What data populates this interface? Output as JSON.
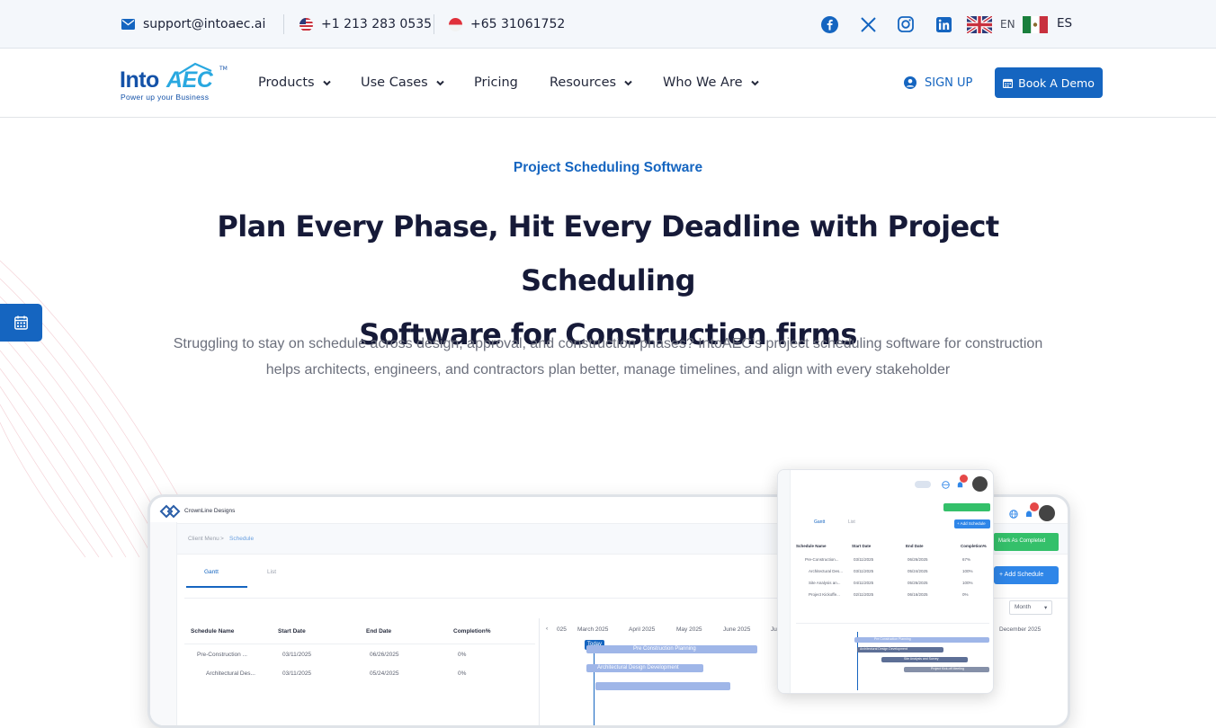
{
  "topbar": {
    "email": "support@intoaec.ai",
    "phone_us": "+1 213 283 0535",
    "phone_sg": "+65 31061752",
    "lang_en": "EN",
    "lang_es": "ES"
  },
  "nav": {
    "logo_into": "Into",
    "logo_aec": "AEC",
    "logo_tm": "TM",
    "logo_tagline": "Power up your Business",
    "items": [
      {
        "label": "Products"
      },
      {
        "label": "Use Cases"
      },
      {
        "label": "Pricing"
      },
      {
        "label": "Resources"
      },
      {
        "label": "Who We Are"
      }
    ],
    "signup": "SIGN UP",
    "book_demo": "Book A Demo"
  },
  "hero": {
    "eyebrow": "Project Scheduling Software",
    "headline_line1": "Plan Every Phase, Hit Every Deadline with Project Scheduling",
    "headline_line2": "Software for Construction firms",
    "subtext_line1": "Struggling to stay on schedule across design, approval, and construction phases? IntoAEC’s project scheduling software for construction",
    "subtext_line2": "helps architects, engineers, and contractors plan better, manage timelines, and align with every stakeholder"
  },
  "mock": {
    "company": "CrownLine Designs",
    "breadcrumb_root": "Client Menu",
    "breadcrumb_sep": ">",
    "breadcrumb_current": "Schedule",
    "tab_gantt": "Gantt",
    "tab_list": "List",
    "col_name": "Schedule Name",
    "col_start": "Start Date",
    "col_end": "End Date",
    "col_completion": "Completion%",
    "rows": [
      {
        "name": "Pre-Construction ...",
        "start": "03/11/2025",
        "end": "06/26/2025",
        "completion": "0%"
      },
      {
        "name": "Architectural Des...",
        "start": "03/11/2025",
        "end": "05/24/2025",
        "completion": "0%"
      }
    ],
    "months": [
      "025",
      "March 2025",
      "April 2025",
      "May 2025",
      "June 2025",
      "Ju",
      "December 2025"
    ],
    "today": "Today",
    "bar1": "Pre Construction Planning",
    "bar2": "Architectural Design Development",
    "mark_completed": "Mark As Completed",
    "add_schedule": "+ Add Schedule",
    "month_select": "Month"
  },
  "phone": {
    "tab_gantt": "Gantt",
    "tab_list": "List",
    "add_btn": "+ Add Schedule",
    "col_name": "Schedule Name",
    "col_start": "Start Date",
    "col_end": "End Date",
    "col_completion": "Completion%",
    "rows": [
      {
        "name": "Pre-Construction...",
        "start": "03/11/2025",
        "end": "06/26/2025",
        "completion": "67%"
      },
      {
        "name": "Architectural Des...",
        "start": "03/11/2025",
        "end": "05/24/2025",
        "completion": "100%"
      },
      {
        "name": "Site Analysis an...",
        "start": "04/11/2025",
        "end": "05/26/2025",
        "completion": "100%"
      },
      {
        "name": "Project Kickoffe...",
        "start": "02/11/2025",
        "end": "06/16/2025",
        "completion": "0%"
      }
    ],
    "bar1": "Pre Construction Planning",
    "bar2": "Architectural Design Development",
    "bar3": "Site Analysis and Survey",
    "bar4": "Project Kick-off Meeting",
    "badge": "10"
  }
}
